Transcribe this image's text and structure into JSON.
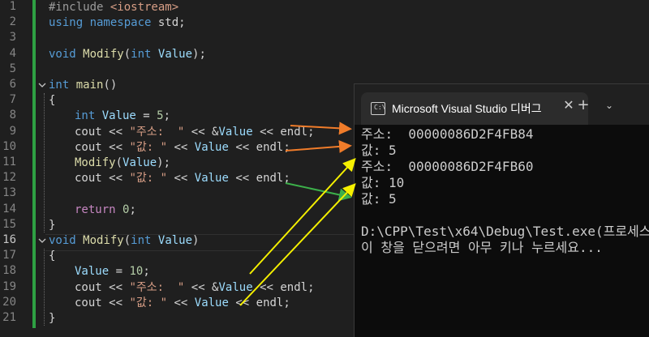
{
  "editor": {
    "line_numbers": [
      "1",
      "2",
      "3",
      "4",
      "5",
      "6",
      "7",
      "8",
      "9",
      "10",
      "11",
      "12",
      "13",
      "14",
      "15",
      "16",
      "17",
      "18",
      "19",
      "20",
      "21"
    ],
    "active_line": "16",
    "code": {
      "l1_pre": "#include ",
      "l1_inc": "<iostream>",
      "l2_kw": "using namespace ",
      "l2_ns": "std;",
      "l4_kw": "void ",
      "l4_fn": "Modify",
      "l4_p1": "(",
      "l4_kw2": "int ",
      "l4_var": "Value",
      "l4_p2": ");",
      "l6_kw": "int ",
      "l6_fn": "main",
      "l6_p": "()",
      "l7": "{",
      "l8_kw": "int ",
      "l8_var": "Value",
      "l8_op": " = ",
      "l8_num": "5",
      "l8_end": ";",
      "l9_a": "cout << ",
      "l9_str": "\"주소:  \"",
      "l9_b": " << &",
      "l9_var": "Value",
      "l9_c": " << endl;",
      "l10_a": "cout << ",
      "l10_str": "\"값: \"",
      "l10_b": " << ",
      "l10_var": "Value",
      "l10_c": " << endl;",
      "l11_fn": "Modify",
      "l11_p1": "(",
      "l11_var": "Value",
      "l11_p2": ");",
      "l12_a": "cout << ",
      "l12_str": "\"값: \"",
      "l12_b": " << ",
      "l12_var": "Value",
      "l12_c": " << endl;",
      "l14_kw": "return ",
      "l14_num": "0",
      "l14_end": ";",
      "l15": "}",
      "l16_kw": "void ",
      "l16_fn": "Modify",
      "l16_p1": "(",
      "l16_kw2": "int ",
      "l16_var": "Value",
      "l16_p2": ")",
      "l17": "{",
      "l18_var": "Value",
      "l18_op": " = ",
      "l18_num": "10",
      "l18_end": ";",
      "l19_a": "cout << ",
      "l19_str": "\"주소:  \"",
      "l19_b": " << &",
      "l19_var": "Value",
      "l19_c": " << endl;",
      "l20_a": "cout << ",
      "l20_str": "\"값: \"",
      "l20_b": " << ",
      "l20_var": "Value",
      "l20_c": " << endl;",
      "l21": "}"
    }
  },
  "terminal": {
    "tab_icon_text": "C:\\",
    "tab_title": "Microsoft Visual Studio 디버그",
    "close_glyph": "✕",
    "new_tab_glyph": "+",
    "dropdown_glyph": "⌄",
    "output": [
      "주소:  00000086D2F4FB84",
      "값: 5",
      "주소:  00000086D2F4FB60",
      "값: 10",
      "값: 5",
      "",
      "D:\\CPP\\Test\\x64\\Debug\\Test.exe(프로세스",
      "이 창을 닫으려면 아무 키나 누르세요..."
    ]
  },
  "annotations": {
    "colors": {
      "orange": "#f07c2a",
      "green": "#3cb04a",
      "yellow": "#f5f000"
    },
    "icons": [
      "terminal-icon",
      "close-icon",
      "plus-icon",
      "chevron-down-icon"
    ]
  }
}
